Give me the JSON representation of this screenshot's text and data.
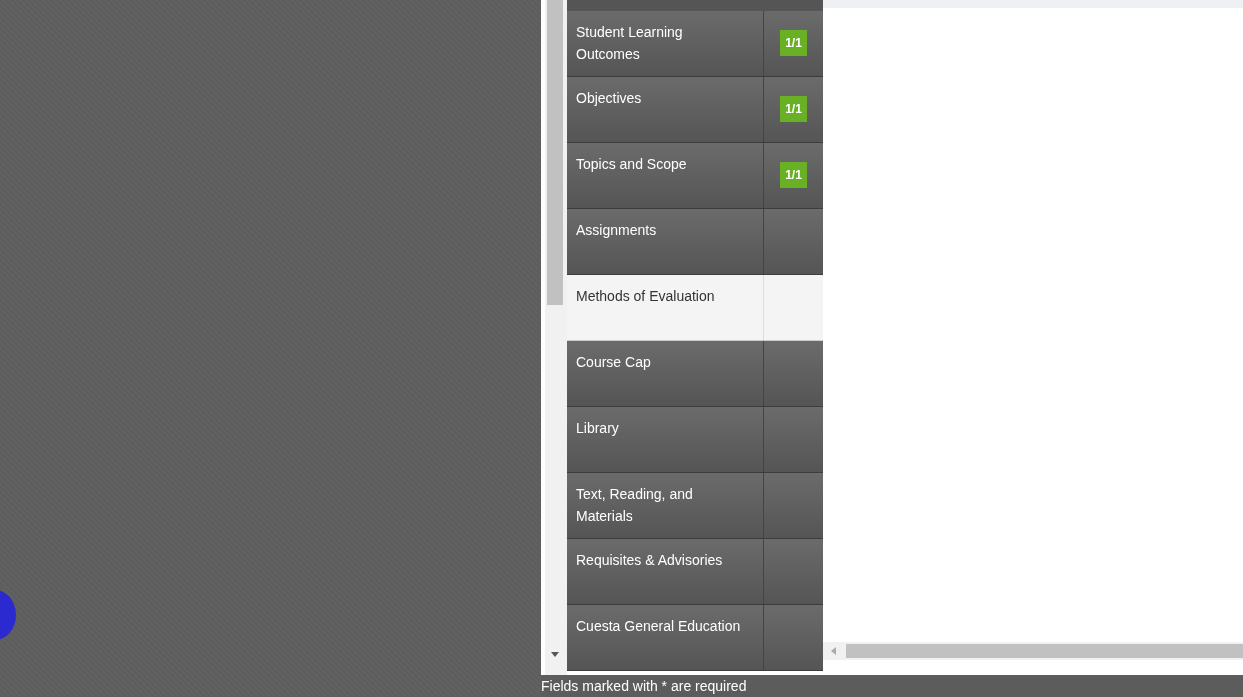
{
  "nav_items": [
    {
      "label": "Student Learning Outcomes",
      "badge": "1/1",
      "selected": false
    },
    {
      "label": "Objectives",
      "badge": "1/1",
      "selected": false
    },
    {
      "label": "Topics and Scope",
      "badge": "1/1",
      "selected": false
    },
    {
      "label": "Assignments",
      "selected": false
    },
    {
      "label": "Methods of Evaluation",
      "selected": true
    },
    {
      "label": "Course Cap",
      "selected": false
    },
    {
      "label": "Library",
      "selected": false
    },
    {
      "label": "Text, Reading, and Materials",
      "selected": false
    },
    {
      "label": "Requisites & Advisories",
      "selected": false
    },
    {
      "label": "Cuesta General Education",
      "selected": false
    }
  ],
  "status_bar": {
    "text": "Fields marked with * are required"
  }
}
